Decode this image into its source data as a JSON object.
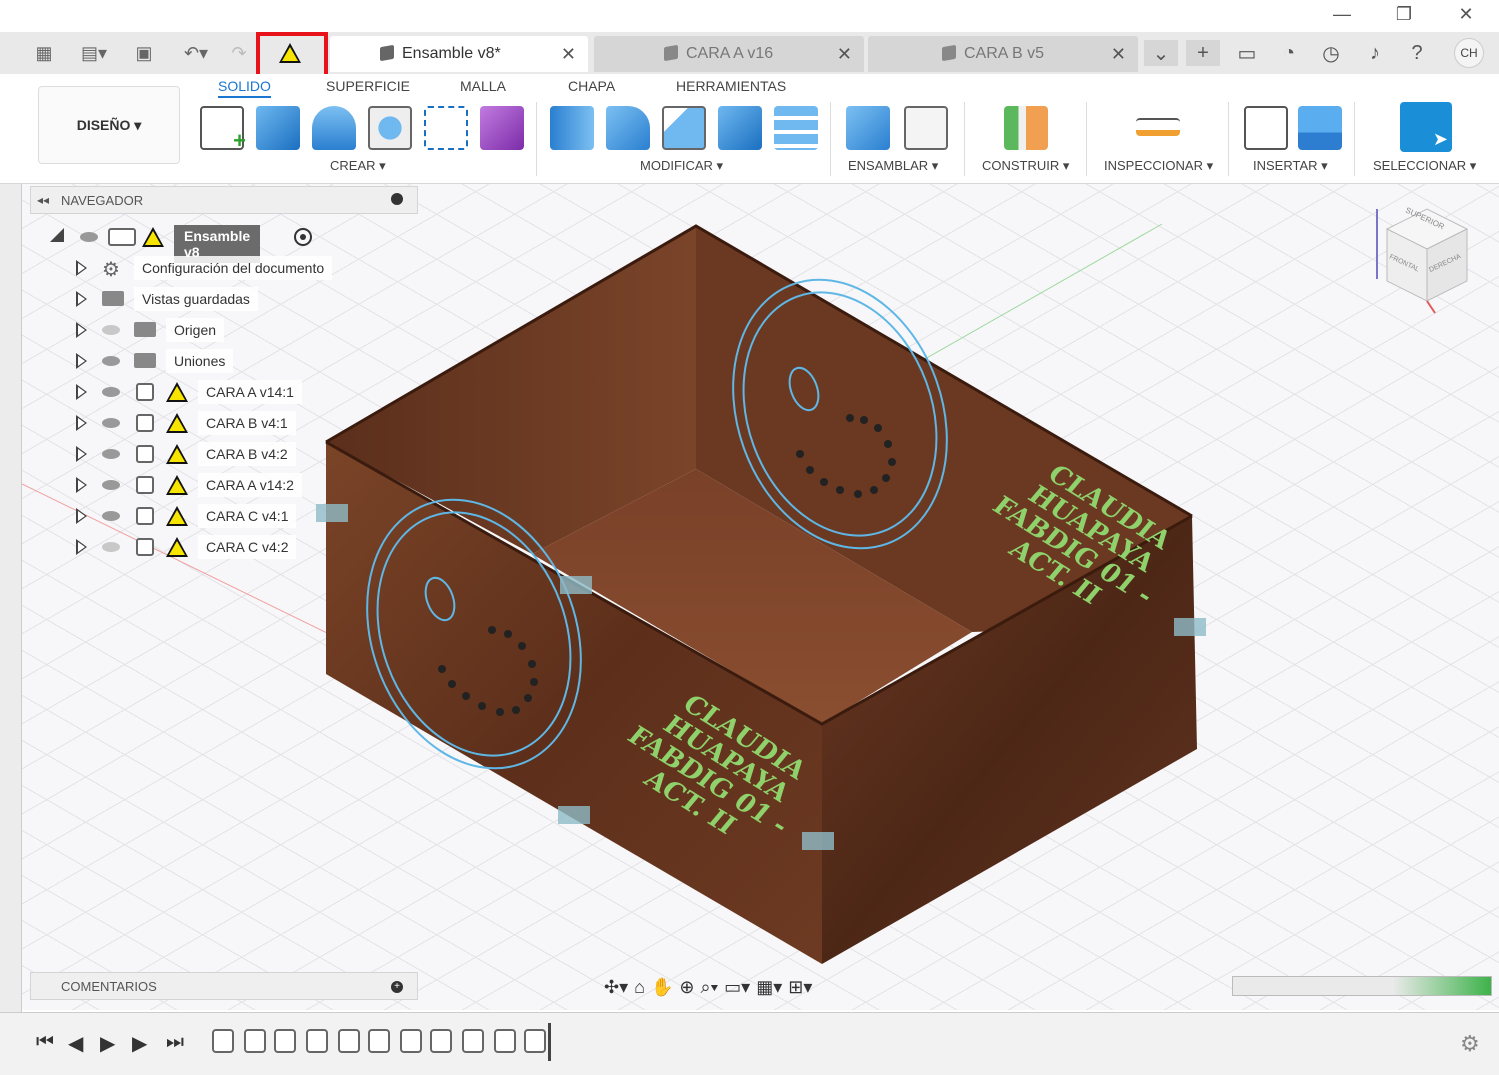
{
  "window": {
    "minimize_icon": "minimize-icon",
    "restore_icon": "restore-icon",
    "close_icon": "close-icon"
  },
  "tabs": [
    {
      "label": "Ensamble v8*",
      "active": true
    },
    {
      "label": "CARA A v16",
      "active": false
    },
    {
      "label": "CARA B v5",
      "active": false
    }
  ],
  "user": {
    "initials": "CH"
  },
  "ribbon": {
    "tabs": [
      "SOLIDO",
      "SUPERFICIE",
      "MALLA",
      "CHAPA",
      "HERRAMIENTAS"
    ],
    "active_tab": "SOLIDO",
    "workspace": "DISEÑO ▾",
    "groups": [
      "CREAR ▾",
      "MODIFICAR ▾",
      "ENSAMBLAR ▾",
      "CONSTRUIR ▾",
      "INSPECCIONAR ▾",
      "INSERTAR ▾",
      "SELECCIONAR ▾"
    ]
  },
  "navigator": {
    "title": "NAVEGADOR",
    "root": "Ensamble v8",
    "items": [
      {
        "label": "Configuración del documento",
        "type": "settings"
      },
      {
        "label": "Vistas guardadas",
        "type": "folder"
      },
      {
        "label": "Origen",
        "type": "folder",
        "hidden": true
      },
      {
        "label": "Uniones",
        "type": "folder"
      },
      {
        "label": "CARA A v14:1",
        "type": "component",
        "warning": true
      },
      {
        "label": "CARA B v4:1",
        "type": "component",
        "warning": true
      },
      {
        "label": "CARA B v4:2",
        "type": "component",
        "warning": true
      },
      {
        "label": "CARA A v14:2",
        "type": "component",
        "warning": true
      },
      {
        "label": "CARA C v4:1",
        "type": "component",
        "warning": true
      },
      {
        "label": "CARA C v4:2",
        "type": "component",
        "warning": true,
        "hidden": true
      }
    ]
  },
  "comments": {
    "title": "COMENTARIOS"
  },
  "model": {
    "engraving_lines": [
      "CLAUDIA",
      "HUAPAYA",
      "FABDIG 01 -",
      "ACT. II"
    ]
  },
  "viewcube": {
    "top": "SUPERIOR",
    "front": "FRONTAL",
    "right": "DERECHA"
  },
  "colors": {
    "accent": "#1976d2",
    "warning": "#f7e400",
    "highlight": "#e8121a",
    "wood": "#6b3a22",
    "engrave": "#8fd16a",
    "sketch": "#5fb7e6"
  }
}
